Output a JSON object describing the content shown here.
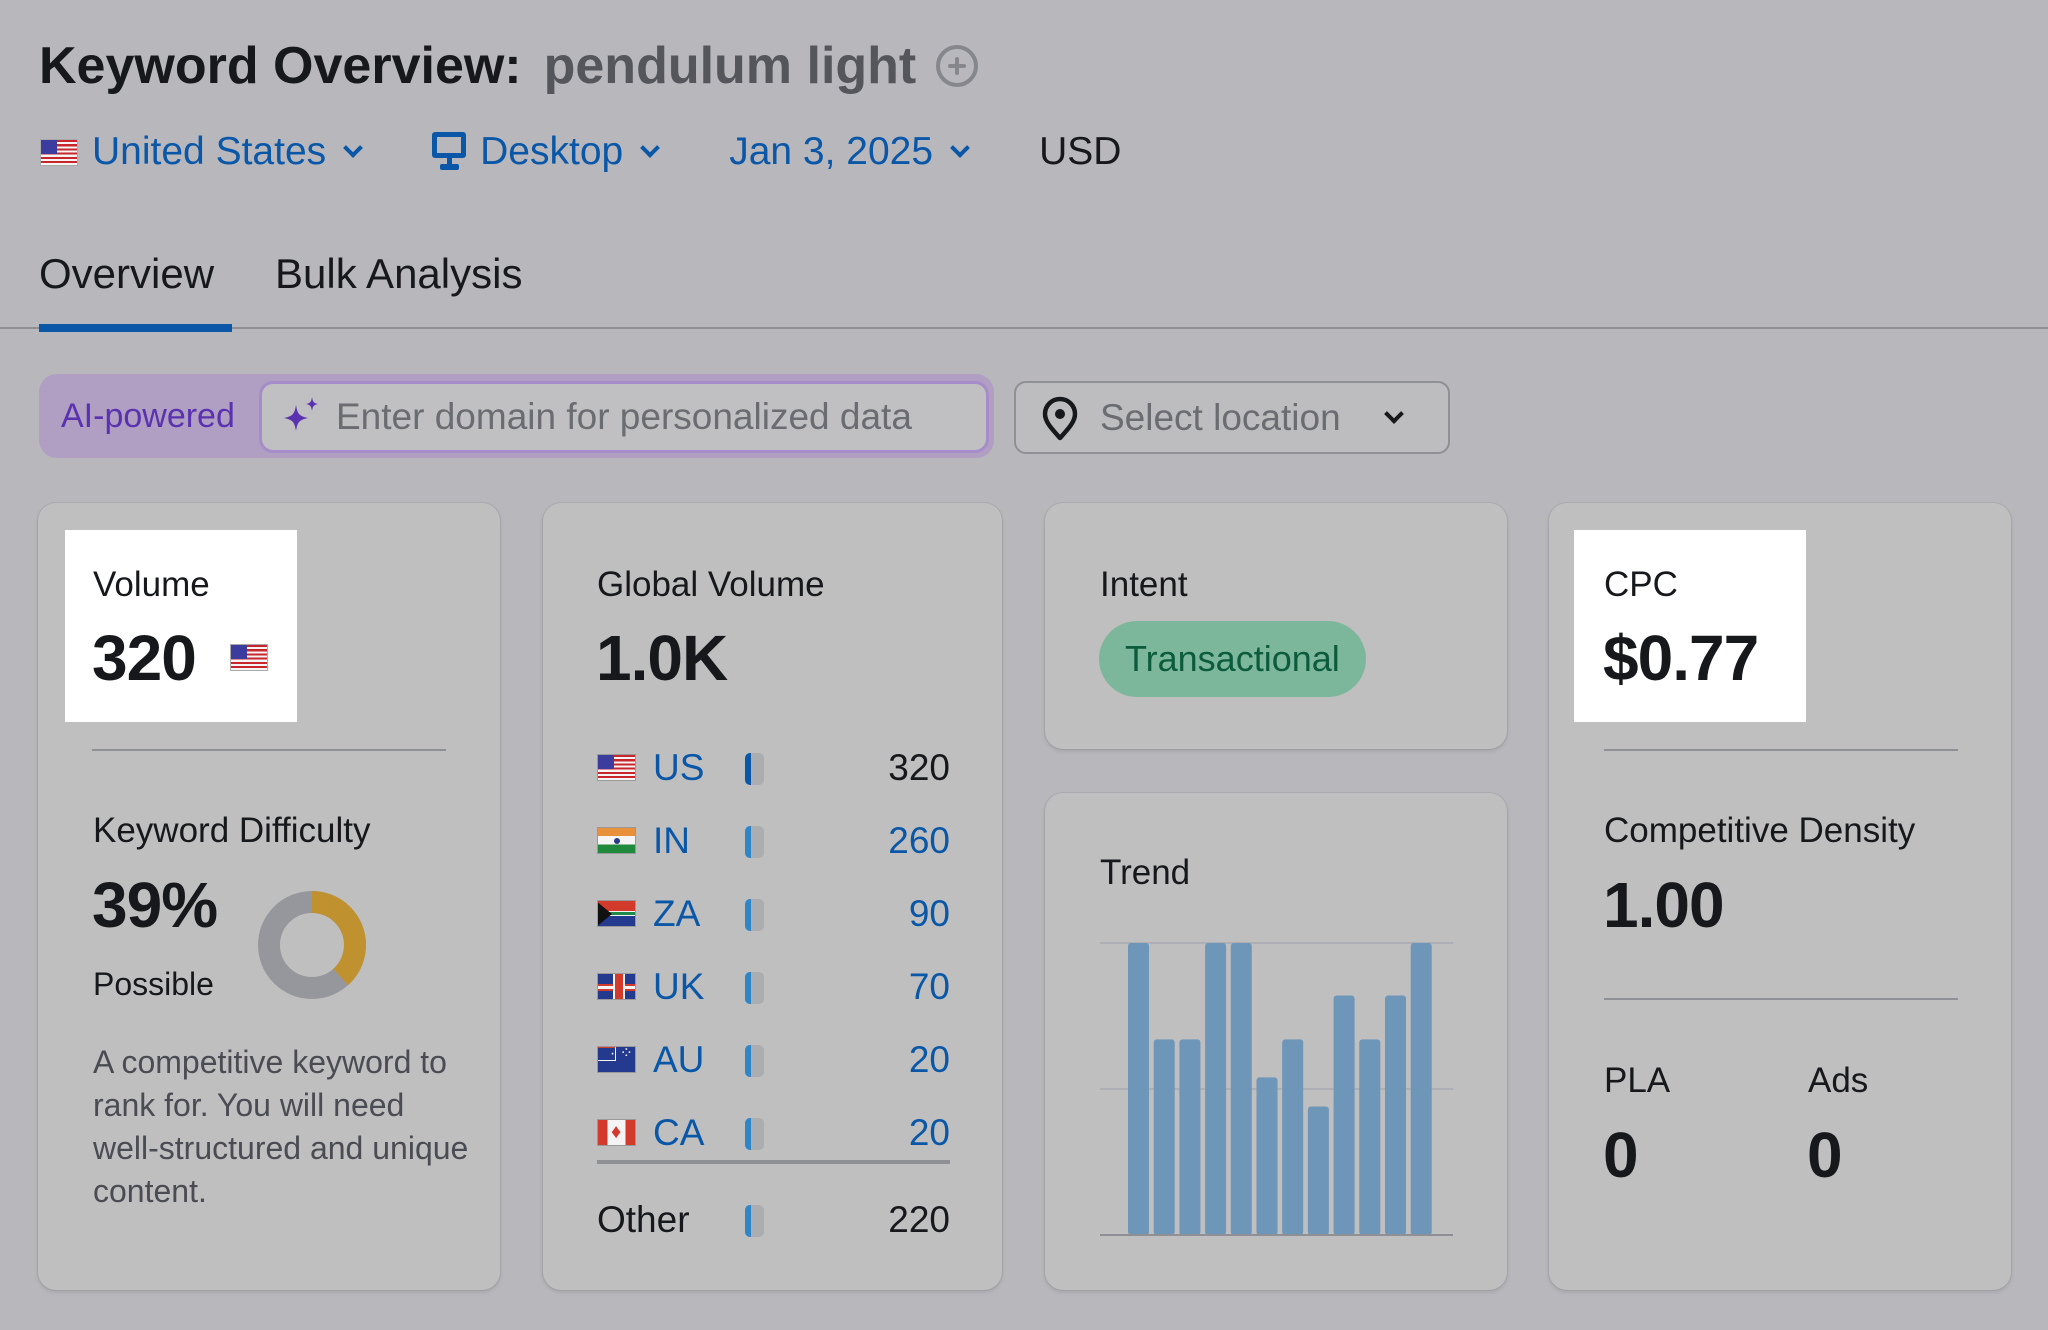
{
  "header": {
    "title_prefix": "Keyword Overview:",
    "keyword": "pendulum light",
    "add_icon": "plus-circle-icon"
  },
  "filters": {
    "country": "United States",
    "country_flag": "us-flag-icon",
    "device": "Desktop",
    "device_icon": "desktop-icon",
    "date": "Jan 3, 2025",
    "currency": "USD"
  },
  "tabs": [
    {
      "label": "Overview",
      "active": true
    },
    {
      "label": "Bulk Analysis",
      "active": false
    }
  ],
  "personalization": {
    "badge": "AI-powered",
    "input_placeholder": "Enter domain for personalized data",
    "input_value": "",
    "location_placeholder": "Select location"
  },
  "volume": {
    "label": "Volume",
    "value": "320",
    "flag": "us-flag-icon"
  },
  "keyword_difficulty": {
    "label": "Keyword Difficulty",
    "value": "39%",
    "percent": 39,
    "level": "Possible",
    "description": "A competitive keyword to rank for. You will need well-structured and unique content.",
    "colors": {
      "filled": "#c0922f",
      "empty": "#96979c"
    }
  },
  "global_volume": {
    "label": "Global Volume",
    "value": "1.0K",
    "countries": [
      {
        "code": "US",
        "value": "320",
        "share": 0.32
      },
      {
        "code": "IN",
        "value": "260",
        "share": 0.26
      },
      {
        "code": "ZA",
        "value": "90",
        "share": 0.09
      },
      {
        "code": "UK",
        "value": "70",
        "share": 0.07
      },
      {
        "code": "AU",
        "value": "20",
        "share": 0.02
      },
      {
        "code": "CA",
        "value": "20",
        "share": 0.02
      }
    ],
    "other": {
      "label": "Other",
      "value": "220",
      "share": 0.22
    }
  },
  "intent": {
    "label": "Intent",
    "badge": "Transactional",
    "badge_color": "#7cb79b"
  },
  "trend": {
    "label": "Trend"
  },
  "chart_data": {
    "type": "bar",
    "title": "Trend",
    "categories": [
      "1",
      "2",
      "3",
      "4",
      "5",
      "6",
      "7",
      "8",
      "9",
      "10",
      "11",
      "12"
    ],
    "values": [
      1.0,
      0.67,
      0.67,
      1.0,
      1.0,
      0.54,
      0.67,
      0.44,
      0.82,
      0.67,
      0.82,
      1.0
    ],
    "ylim": [
      0,
      1.0
    ],
    "gridlines": [
      0.5,
      1.0
    ],
    "grid": true,
    "xlabel": "",
    "ylabel": "",
    "color": "#6d96b9"
  },
  "cpc": {
    "label": "CPC",
    "value": "$0.77"
  },
  "competitive_density": {
    "label": "Competitive Density",
    "value": "1.00"
  },
  "pla": {
    "label": "PLA",
    "value": "0"
  },
  "ads": {
    "label": "Ads",
    "value": "0"
  }
}
